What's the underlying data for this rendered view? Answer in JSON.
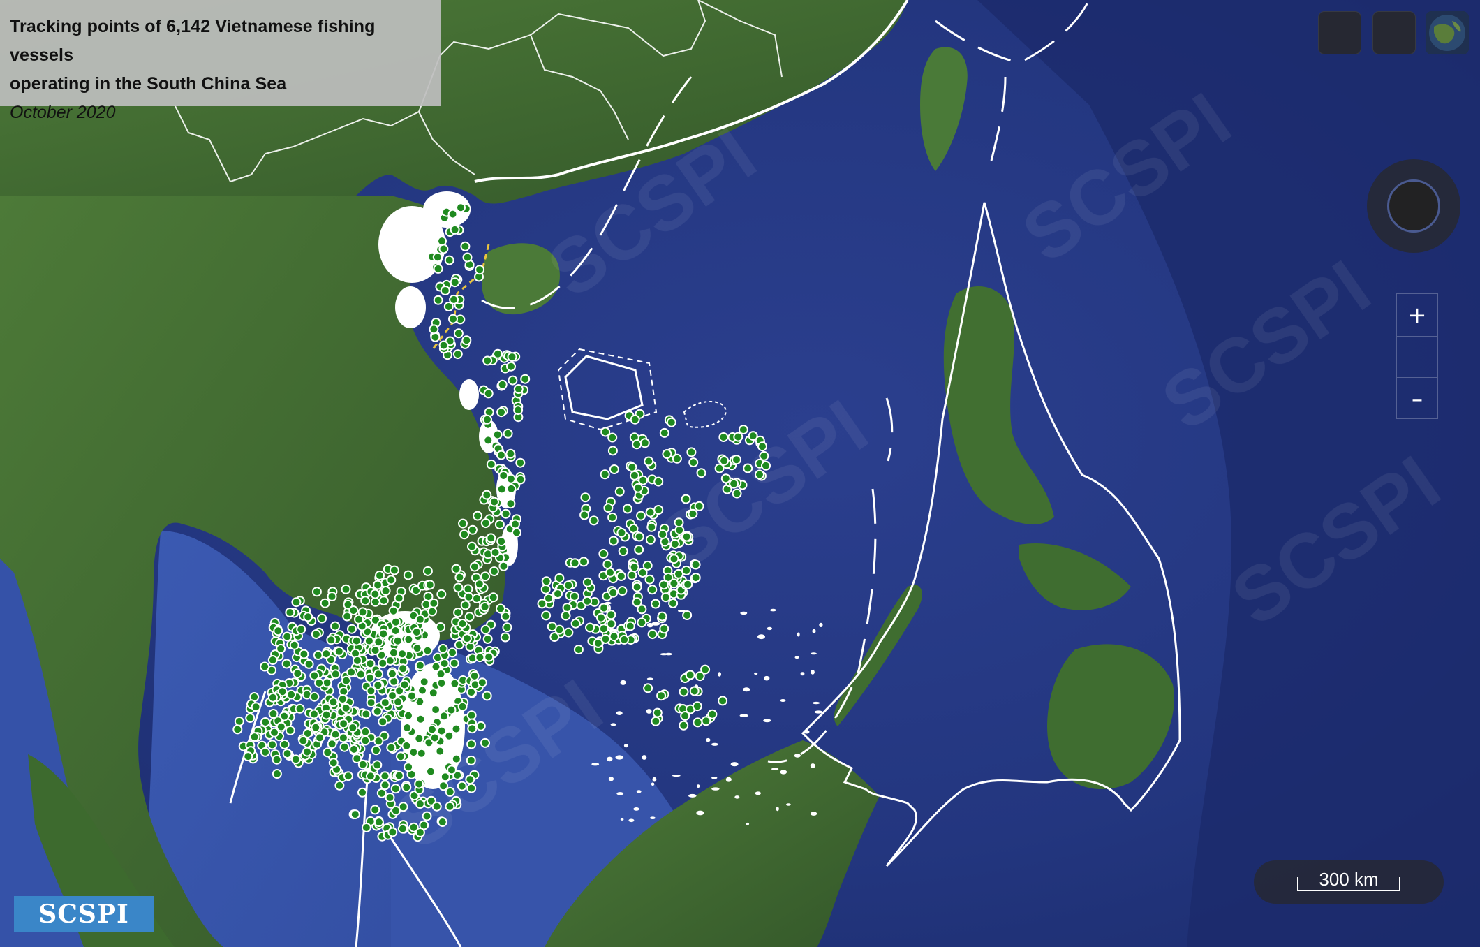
{
  "header": {
    "title_line1": "Tracking points of 6,142 Vietnamese fishing vessels",
    "title_line2": "operating in the South China Sea",
    "date": "October 2020"
  },
  "watermark": "SCSPI",
  "logo": {
    "text": "SCSPI"
  },
  "controls": {
    "zoom_in": "+",
    "zoom_out": "–",
    "layer_icon_1": "square-icon",
    "layer_icon_2": "square-icon",
    "basemap_icon": "globe-thumbnail-icon",
    "compass_icon": "compass-icon"
  },
  "scale_bar": {
    "label": "300 km"
  },
  "colors": {
    "vessel_point": "#1f8a1f",
    "vessel_outline": "#ffffff",
    "sea": "#2a3f90",
    "land": "#3f6b2e",
    "title_bg": "#bebebe"
  }
}
